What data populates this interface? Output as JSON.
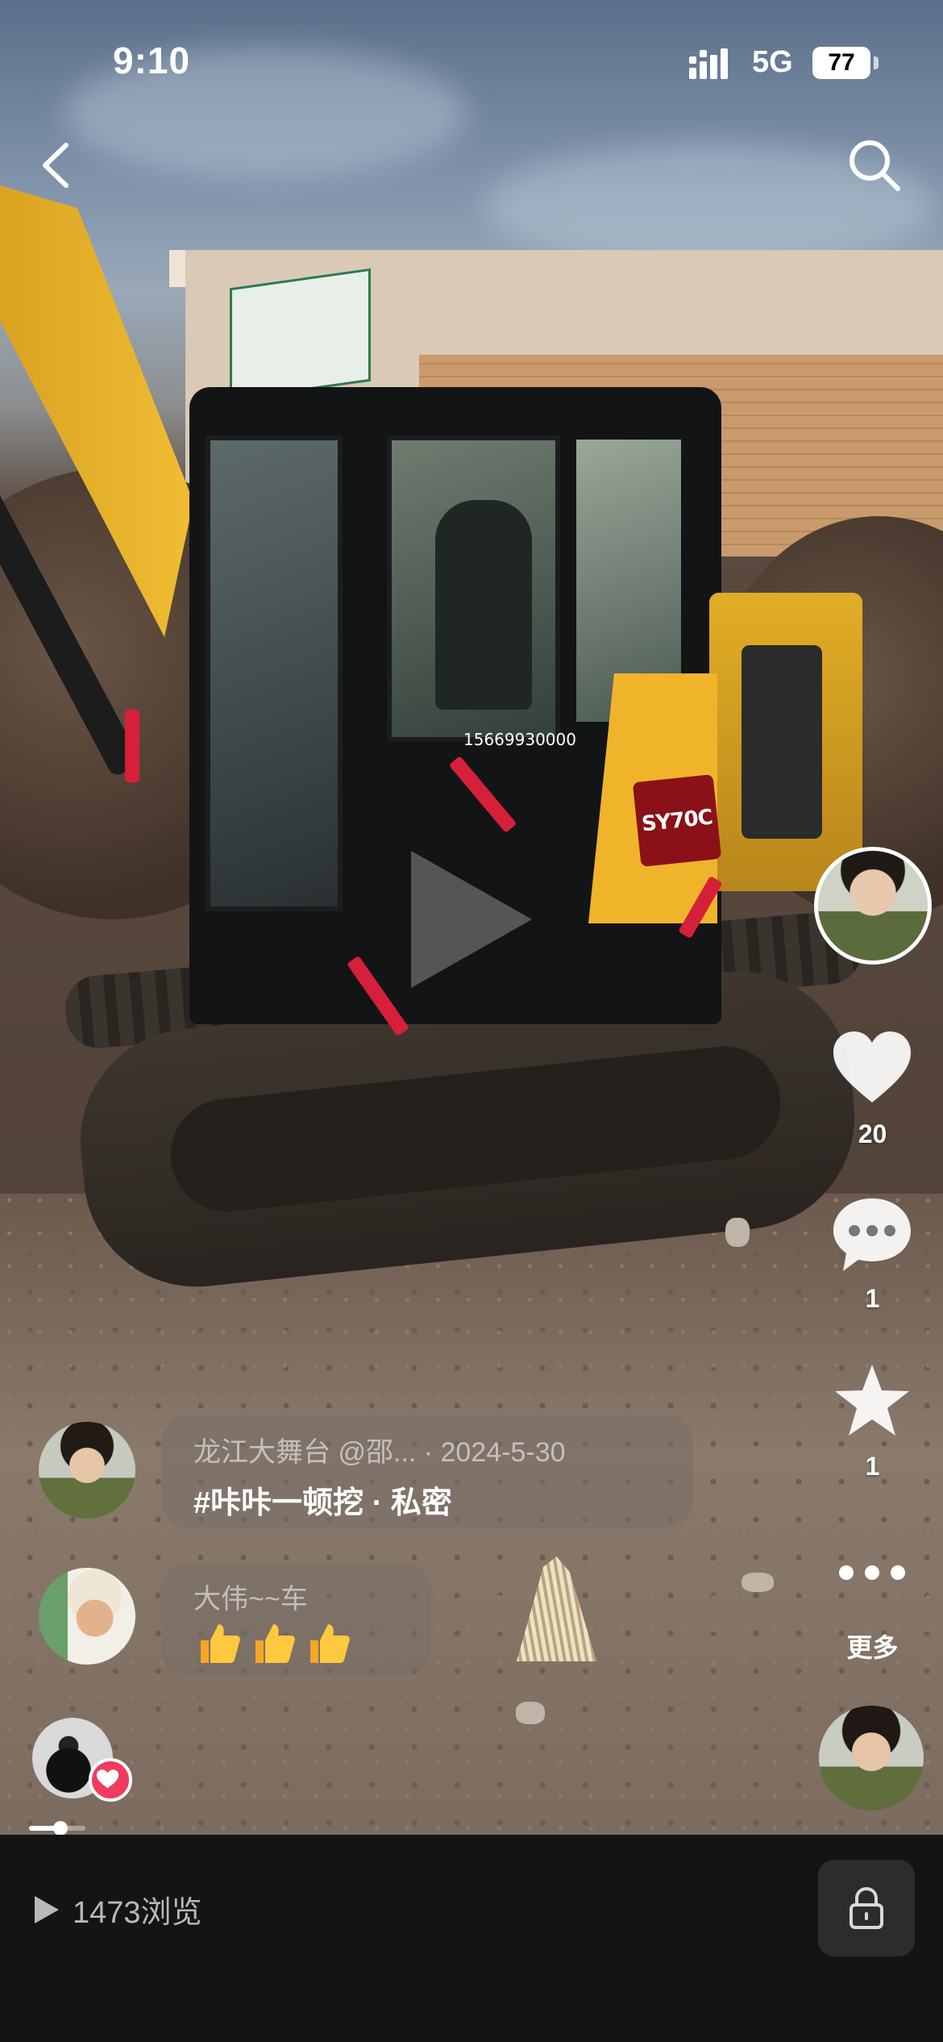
{
  "status_bar": {
    "time": "9:10",
    "network": "5G",
    "battery": "77"
  },
  "nav": {
    "back_icon": "chevron-left-icon",
    "search_icon": "search-icon"
  },
  "video": {
    "cab_phone": "15669930000",
    "model_badge": "SY70C"
  },
  "rail": {
    "like_count": "20",
    "comment_count": "1",
    "favorite_count": "1",
    "more_label": "更多"
  },
  "comments": [
    {
      "meta": "龙江大舞台  @邵... · 2024-5-30",
      "text": "#咔咔一顿挖 · 私密"
    },
    {
      "meta": "大伟~~车",
      "text": ""
    }
  ],
  "progress": {
    "fraction": 0.55
  },
  "bottom_bar": {
    "views": "1473浏览",
    "lock_icon": "lock-icon"
  },
  "colors": {
    "like_badge": "#f23a5e",
    "bottom_bar": "#141414",
    "excavator_yellow": "#e7b22b"
  }
}
